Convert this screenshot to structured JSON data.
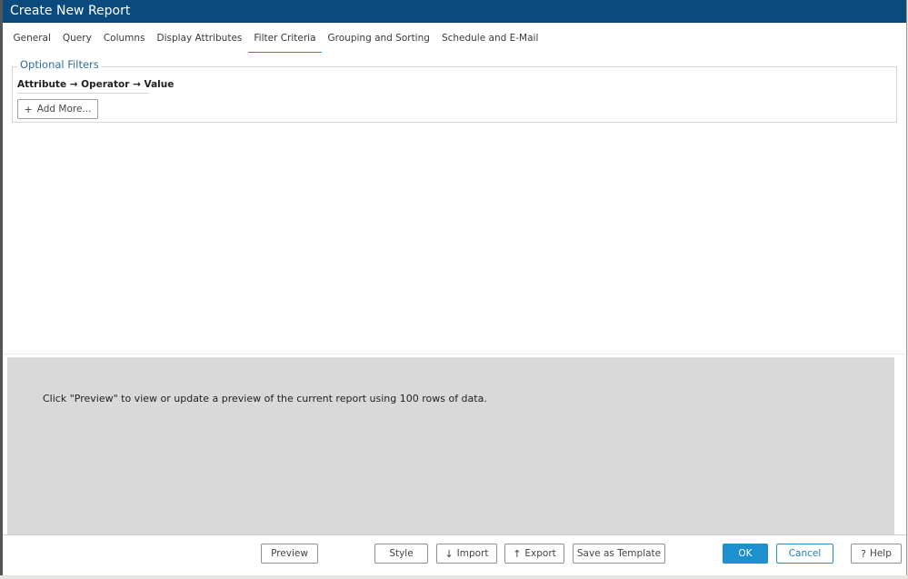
{
  "window": {
    "title": "Create New Report"
  },
  "tabs": [
    {
      "label": "General"
    },
    {
      "label": "Query"
    },
    {
      "label": "Columns"
    },
    {
      "label": "Display Attributes"
    },
    {
      "label": "Filter Criteria"
    },
    {
      "label": "Grouping and Sorting"
    },
    {
      "label": "Schedule and E-Mail"
    }
  ],
  "active_tab": "Filter Criteria",
  "optional_filters": {
    "legend": "Optional Filters",
    "header": "Attribute → Operator → Value",
    "add_more_label": "Add More...",
    "add_more_icon": "plus-icon"
  },
  "preview": {
    "message": "Click \"Preview\" to view or update a preview of the current report using 100 rows of data."
  },
  "footer": {
    "preview_label": "Preview",
    "style_label": "Style",
    "import_label": "Import",
    "import_icon": "arrow-down-icon",
    "export_label": "Export",
    "export_icon": "arrow-up-icon",
    "save_template_label": "Save as Template",
    "ok_label": "OK",
    "cancel_label": "Cancel",
    "help_label": "Help",
    "help_icon": "question-icon"
  },
  "colors": {
    "titlebar": "#0b4a7d",
    "accent": "#1e90d0",
    "preview_bg": "#d9d9d9"
  }
}
